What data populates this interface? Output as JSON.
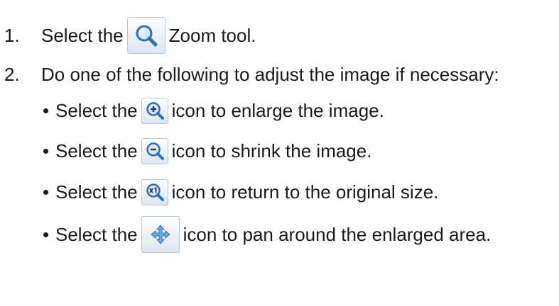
{
  "steps": [
    {
      "number": "1.",
      "before": "Select the",
      "icon": "zoom-tool-icon",
      "after": "Zoom tool."
    },
    {
      "number": "2.",
      "text": "Do one of the following to adjust the image if necessary:"
    }
  ],
  "bullets": [
    {
      "before": "Select the",
      "icon": "zoom-in-icon",
      "after": "icon to enlarge the image."
    },
    {
      "before": "Select the",
      "icon": "zoom-out-icon",
      "after": "icon to shrink the image."
    },
    {
      "before": "Select the",
      "icon": "zoom-actual-size-icon",
      "after": "icon to return to the original size."
    },
    {
      "before": "Select the",
      "icon": "pan-icon",
      "after": "icon to pan around the enlarged area."
    }
  ],
  "colors": {
    "text": "#1a1a1a",
    "icon_blue": "#2f6fb7",
    "button_border": "#b8c6d6"
  }
}
